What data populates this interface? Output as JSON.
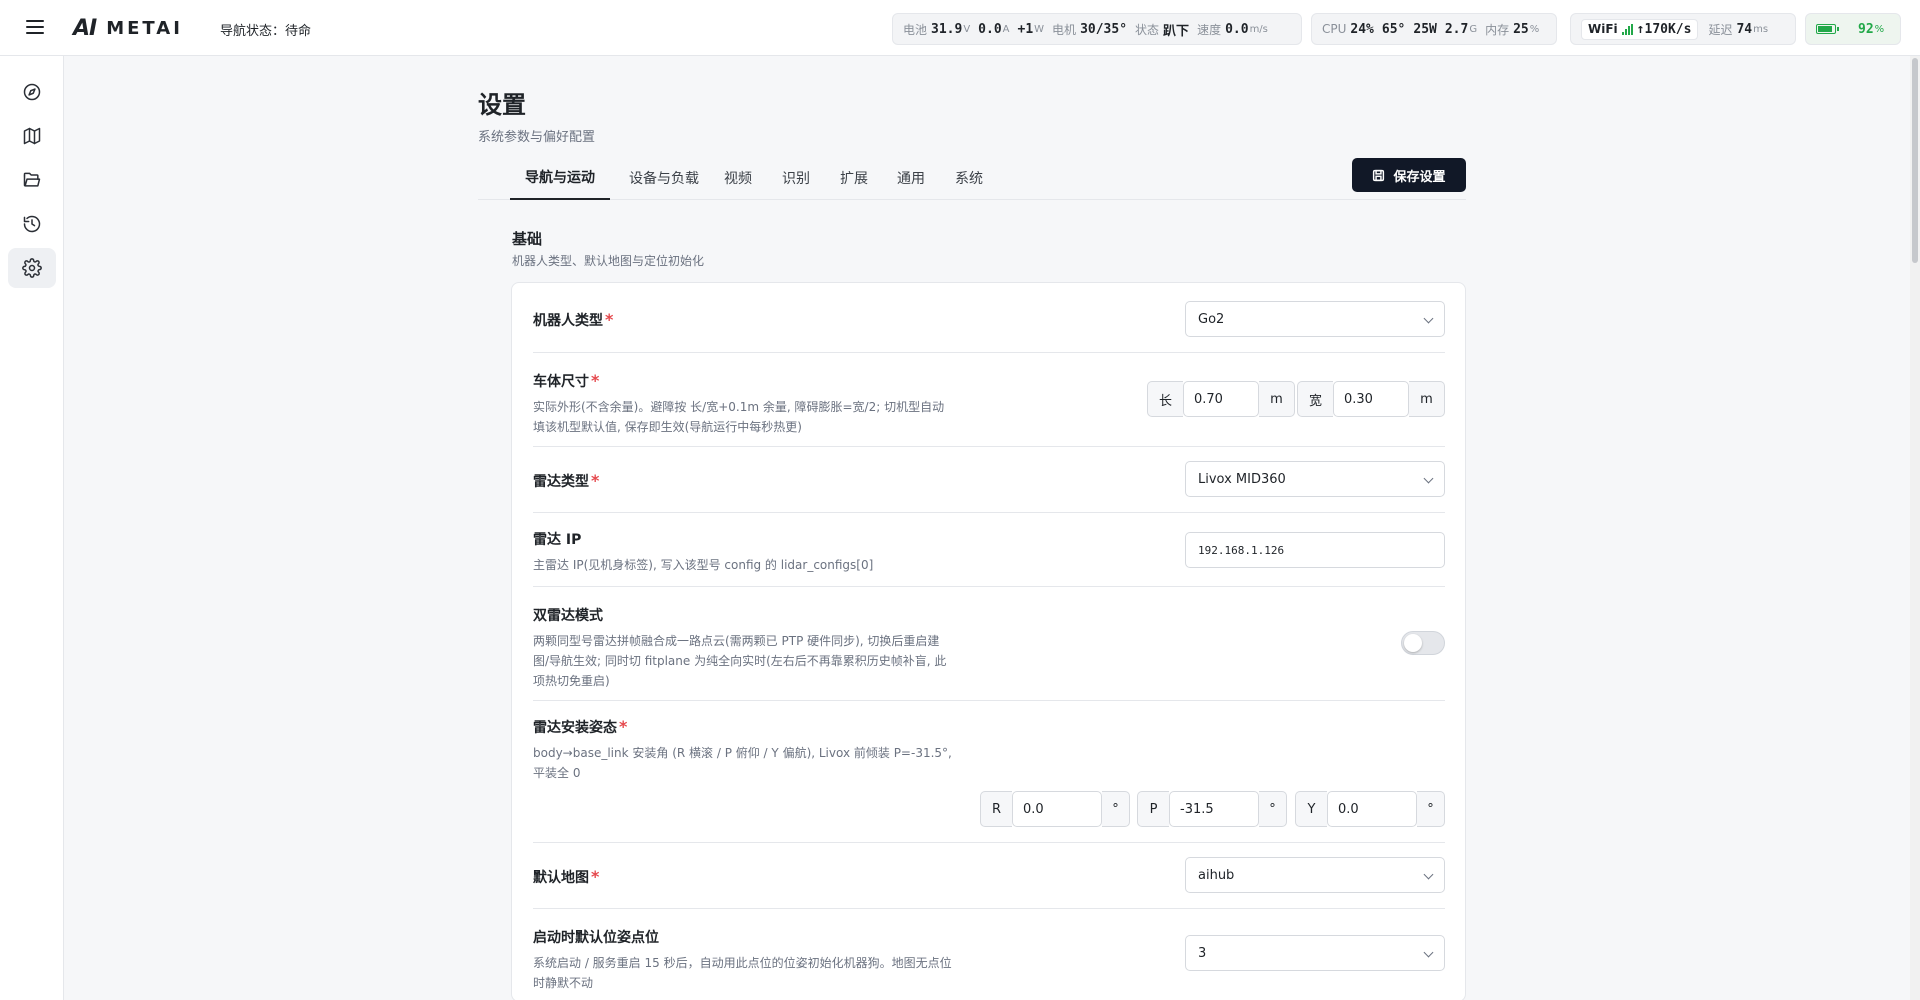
{
  "header": {
    "logo_mark": "AI",
    "logo_text": "METAI",
    "nav_status": "导航状态：待命",
    "power": {
      "battery_label": "电池",
      "voltage": "31.9",
      "voltage_unit": "V",
      "current": "0.0",
      "current_unit": "A",
      "watts": "+1",
      "watts_unit": "W",
      "motor_label": "电机",
      "motor_temp": "30/35°",
      "state_label": "状态",
      "state": "趴下",
      "speed_label": "速度",
      "speed": "0.0",
      "speed_unit": "m/s"
    },
    "system": {
      "cpu_label": "CPU",
      "cpu": "24%",
      "cpu_temp": "65°",
      "power": "25W",
      "mem_total": "2.7",
      "mem_unit": "G",
      "mem_label": "内存",
      "mem": "25",
      "mem_pct_unit": "%"
    },
    "network": {
      "wifi_label": "WiFi",
      "rate": "↑170K/s",
      "latency_label": "延迟",
      "latency": "74",
      "latency_unit": "ms"
    },
    "battery": {
      "percent": "92",
      "percent_unit": "%",
      "level": 0.92,
      "color": "#22a849"
    }
  },
  "sidebar": {
    "items": [
      {
        "icon": "compass-icon",
        "active": false
      },
      {
        "icon": "map-icon",
        "active": false
      },
      {
        "icon": "folder-icon",
        "active": false
      },
      {
        "icon": "history-icon",
        "active": false
      },
      {
        "icon": "gear-icon",
        "active": true
      }
    ]
  },
  "page": {
    "title": "设置",
    "subtitle": "系统参数与偏好配置",
    "tabs": [
      {
        "label": "导航与运动",
        "active": true
      },
      {
        "label": "设备与负载"
      },
      {
        "label": "视频"
      },
      {
        "label": "识别"
      },
      {
        "label": "扩展"
      },
      {
        "label": "通用"
      },
      {
        "label": "系统"
      }
    ],
    "save_label": "保存设置",
    "section": {
      "title": "基础",
      "desc": "机器人类型、默认地图与定位初始化"
    }
  },
  "fields": {
    "robot_type": {
      "label": "机器人类型",
      "required": "*",
      "value": "Go2"
    },
    "body_size": {
      "label": "车体尺寸",
      "required": "*",
      "desc": "实际外形(不含余量)。避障按 长/宽+0.1m 余量, 障碍膨胀=宽/2; 切机型自动填该机型默认值, 保存即生效(导航运行中每秒热更)",
      "length_label": "长",
      "length": "0.70",
      "length_unit": "m",
      "width_label": "宽",
      "width": "0.30",
      "width_unit": "m"
    },
    "lidar_type": {
      "label": "雷达类型",
      "required": "*",
      "value": "Livox MID360"
    },
    "lidar_ip": {
      "label": "雷达 IP",
      "desc": "主雷达 IP(见机身标签), 写入该型号 config 的 lidar_configs[0]",
      "value": "192.168.1.126"
    },
    "dual_lidar": {
      "label": "双雷达模式",
      "desc": "两颗同型号雷达拼帧融合成一路点云(需两颗已 PTP 硬件同步), 切换后重启建图/导航生效; 同时切 fitplane 为纯全向实时(左右后不再靠累积历史帧补盲, 此项热切免重启)",
      "enabled": false
    },
    "lidar_pose": {
      "label": "雷达安装姿态",
      "required": "*",
      "desc": "body→base_link 安装角 (R 横滚 / P 俯仰 / Y 偏航), Livox 前倾装 P=-31.5°, 平装全 0",
      "r_label": "R",
      "r": "0.0",
      "p_label": "P",
      "p": "-31.5",
      "y_label": "Y",
      "y": "0.0",
      "deg": "°"
    },
    "default_map": {
      "label": "默认地图",
      "required": "*",
      "value": "aihub"
    },
    "init_pose": {
      "label": "启动时默认位姿点位",
      "desc": "系统启动 / 服务重启 15 秒后，自动用此点位的位姿初始化机器狗。地图无点位时静默不动",
      "value": "3"
    }
  }
}
